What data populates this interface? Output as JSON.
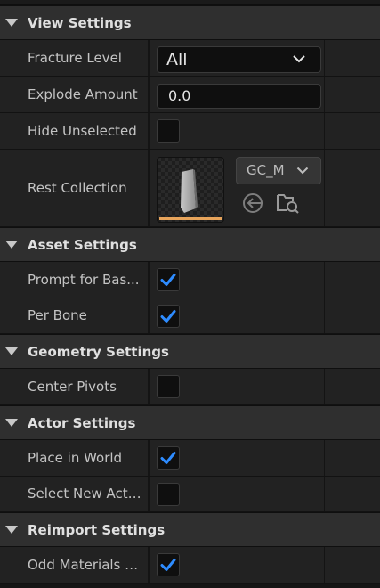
{
  "colors": {
    "accent_check": "#2e8cff",
    "thumb_bar": "#e7a45b",
    "section_bg": "#2f2f2f",
    "row_bg": "#222222",
    "field_bg": "#0f0f0f"
  },
  "sections": {
    "view": {
      "title": "View Settings",
      "fracture_level": {
        "label": "Fracture Level",
        "value": "All"
      },
      "explode_amount": {
        "label": "Explode Amount",
        "value": "0.0"
      },
      "hide_unselected": {
        "label": "Hide Unselected",
        "checked": false
      },
      "rest_collection": {
        "label": "Rest Collection",
        "asset": "GC_M"
      }
    },
    "asset": {
      "title": "Asset Settings",
      "prompt_for_base": {
        "label": "Prompt for Bas...",
        "checked": true
      },
      "per_bone": {
        "label": "Per Bone",
        "checked": true
      }
    },
    "geometry": {
      "title": "Geometry Settings",
      "center_pivots": {
        "label": "Center Pivots",
        "checked": false
      }
    },
    "actor": {
      "title": "Actor Settings",
      "place_in_world": {
        "label": "Place in World",
        "checked": true
      },
      "select_new_actor": {
        "label": "Select New Acto...",
        "checked": false
      }
    },
    "reimport": {
      "title": "Reimport Settings",
      "odd_materials": {
        "label": "Odd Materials A...",
        "checked": true
      }
    }
  },
  "icons": {
    "use_selected": "arrow-left-circle-icon",
    "browse": "folder-search-icon"
  }
}
